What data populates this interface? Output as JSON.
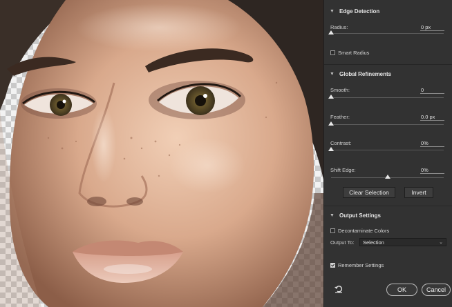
{
  "panel": {
    "edge_detection": {
      "title": "Edge Detection",
      "radius": {
        "label": "Radius:",
        "value": "0 px",
        "fraction": 0.0
      },
      "smart_radius": {
        "label": "Smart Radius",
        "checked": false
      }
    },
    "global_refinements": {
      "title": "Global Refinements",
      "smooth": {
        "label": "Smooth:",
        "value": "0",
        "fraction": 0.0
      },
      "feather": {
        "label": "Feather:",
        "value": "0.0 px",
        "fraction": 0.0
      },
      "contrast": {
        "label": "Contrast:",
        "value": "0%",
        "fraction": 0.0
      },
      "shift_edge": {
        "label": "Shift Edge:",
        "value": "0%",
        "fraction": 0.5
      },
      "clear_selection_label": "Clear Selection",
      "invert_label": "Invert"
    },
    "output_settings": {
      "title": "Output Settings",
      "decontaminate": {
        "label": "Decontaminate Colors",
        "checked": false
      },
      "output_to": {
        "label": "Output To:",
        "value": "Selection"
      },
      "remember": {
        "label": "Remember Settings",
        "checked": true
      }
    },
    "footer": {
      "ok_label": "OK",
      "cancel_label": "Cancel"
    }
  },
  "icons": {
    "section_toggle": "chevron-down-icon",
    "reset": "reset-icon",
    "dropdown": "chevron-down-icon"
  },
  "colors": {
    "panel_bg": "#323232",
    "text": "#d6d6d6",
    "transparency_light": "#f2f2f2",
    "transparency_dark": "#c9c9c9"
  }
}
